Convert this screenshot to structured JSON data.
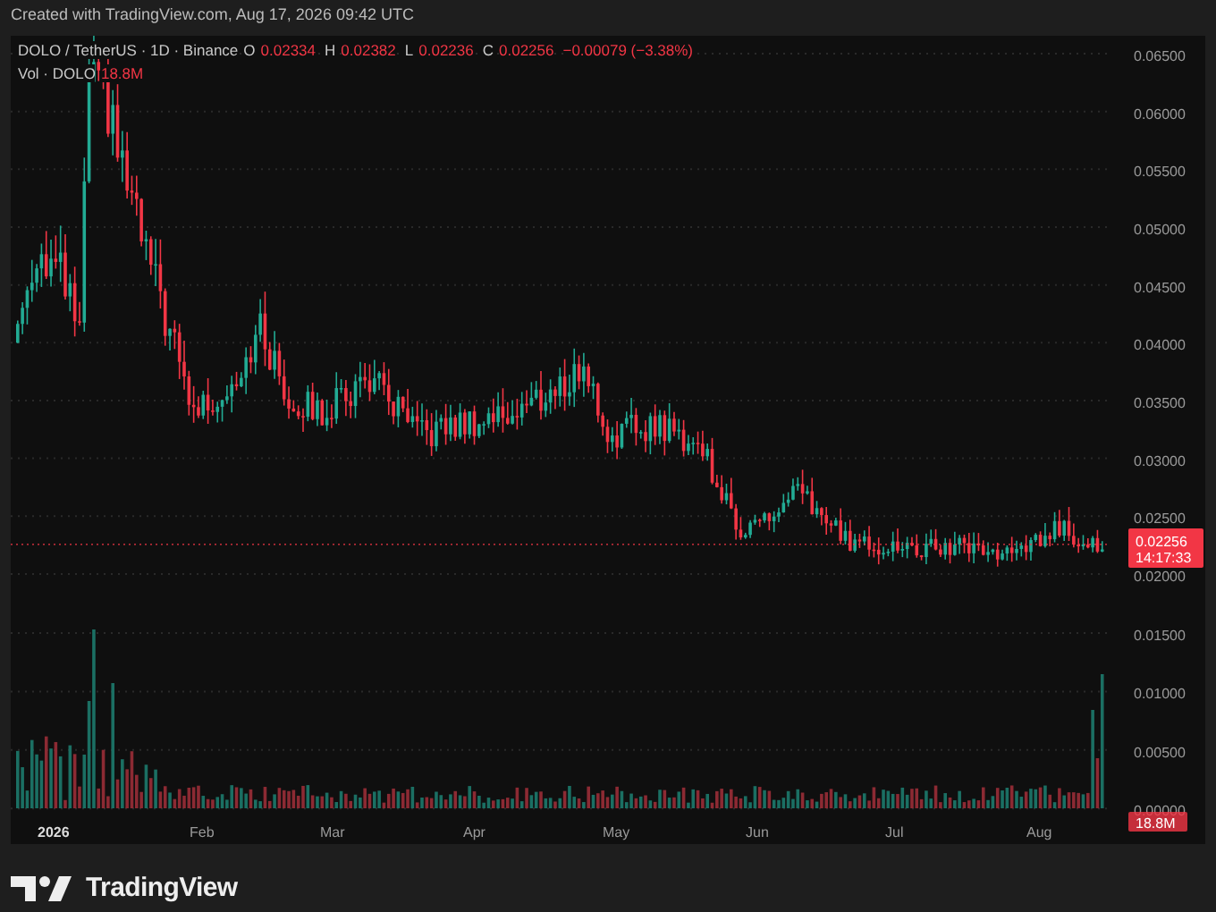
{
  "caption": "Created with TradingView.com, Aug 17, 2026 09:42 UTC",
  "legend": {
    "symbol": "DOLO / TetherUS · 1D · Binance",
    "fields": [
      {
        "label": "O",
        "value": "0.02334"
      },
      {
        "label": "H",
        "value": "0.02382"
      },
      {
        "label": "L",
        "value": "0.02236"
      },
      {
        "label": "C",
        "value": "0.02256"
      }
    ],
    "change": "−0.00079 (−3.38%)"
  },
  "volume_legend": {
    "label": "Vol · DOLO",
    "value": "18.8M"
  },
  "price_axis": [
    "0.06500",
    "0.06000",
    "0.05500",
    "0.05000",
    "0.04500",
    "0.04000",
    "0.03500",
    "0.03000",
    "0.02500",
    "0.02000"
  ],
  "volume_axis": [
    "0.01500",
    "0.01000",
    "0.00500",
    "0.00000"
  ],
  "time_axis": [
    "2026",
    "Feb",
    "Mar",
    "Apr",
    "May",
    "Jun",
    "Jul",
    "Aug"
  ],
  "last_price": {
    "value": "0.02256",
    "countdown": "14:17:33"
  },
  "last_volume": "18.8M",
  "footer": {
    "logo_text": "TradingView"
  }
}
